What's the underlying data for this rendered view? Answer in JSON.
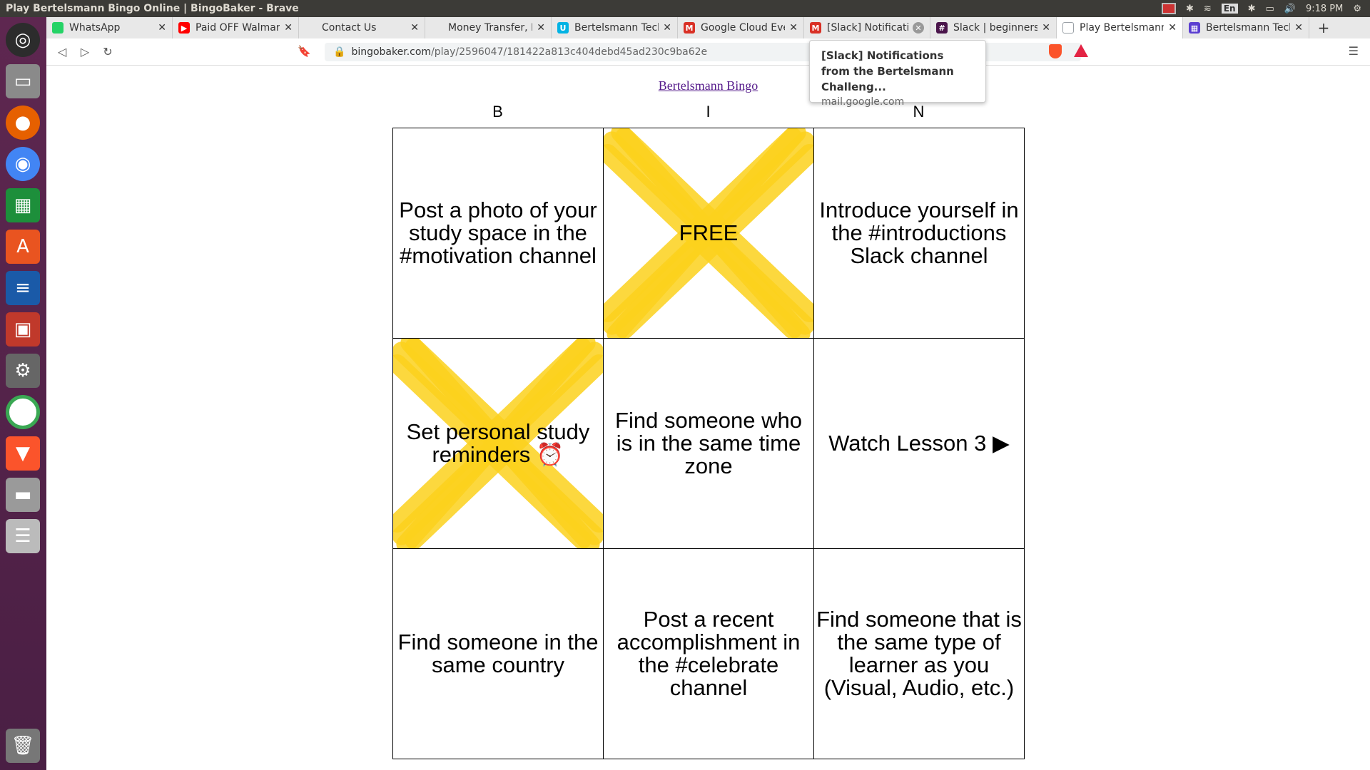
{
  "window": {
    "title": "Play Bertelsmann Bingo Online | BingoBaker - Brave"
  },
  "system_tray": {
    "keyboard": "En",
    "clock": "9:18 PM"
  },
  "tabs": [
    {
      "label": "WhatsApp",
      "icon": "whatsapp-icon",
      "color": "#25d366"
    },
    {
      "label": "Paid OFF Walmart",
      "icon": "youtube-icon",
      "color": "#ff0000"
    },
    {
      "label": "Contact Us",
      "icon": "blank-page-icon",
      "color": "#cccccc"
    },
    {
      "label": "Money Transfer, F",
      "icon": "blank-page-icon",
      "color": "#cccccc"
    },
    {
      "label": "Bertelsmann Tech",
      "icon": "udacity-icon",
      "color": "#02b3e4"
    },
    {
      "label": "Google Cloud Eve",
      "icon": "gmail-icon",
      "color": "#d93025"
    },
    {
      "label": "[Slack] Notificatio",
      "icon": "gmail-icon",
      "color": "#d93025"
    },
    {
      "label": "Slack | beginners",
      "icon": "slack-icon",
      "color": "#4a154b"
    },
    {
      "label": "Play Bertelsmann",
      "icon": "bingobaker-icon",
      "color": "#9aa0a6"
    },
    {
      "label": "Bertelsmann Tech",
      "icon": "calendar-icon",
      "color": "#5b3fd1"
    }
  ],
  "address_bar": {
    "host": "bingobaker.com",
    "path": "/play/2596047/181422a813c404debd45ad230c9ba62e"
  },
  "tooltip": {
    "title": "[Slack] Notifications from the Bertelsmann Challeng...",
    "host": "mail.google.com"
  },
  "bingo": {
    "title": "Bertelsmann Bingo",
    "columns": [
      "B",
      "I",
      "N"
    ],
    "cells": [
      {
        "text": "Post a photo of your study space in the #motivation channel",
        "marked": false
      },
      {
        "text": "FREE",
        "marked": true
      },
      {
        "text": "Introduce yourself in the #introductions Slack channel",
        "marked": false
      },
      {
        "text": "Set personal study reminders ⏰",
        "marked": true
      },
      {
        "text": "Find someone who is in the same time zone",
        "marked": false
      },
      {
        "text": "Watch Lesson 3 ▶",
        "marked": false
      },
      {
        "text": "Find someone in the same country",
        "marked": false
      },
      {
        "text": "Post a recent accomplishment in the #celebrate channel",
        "marked": false
      },
      {
        "text": "Find someone that is the same type of learner as you (Visual, Audio, etc.)",
        "marked": false
      }
    ],
    "mark_color": "#fcd21d"
  }
}
